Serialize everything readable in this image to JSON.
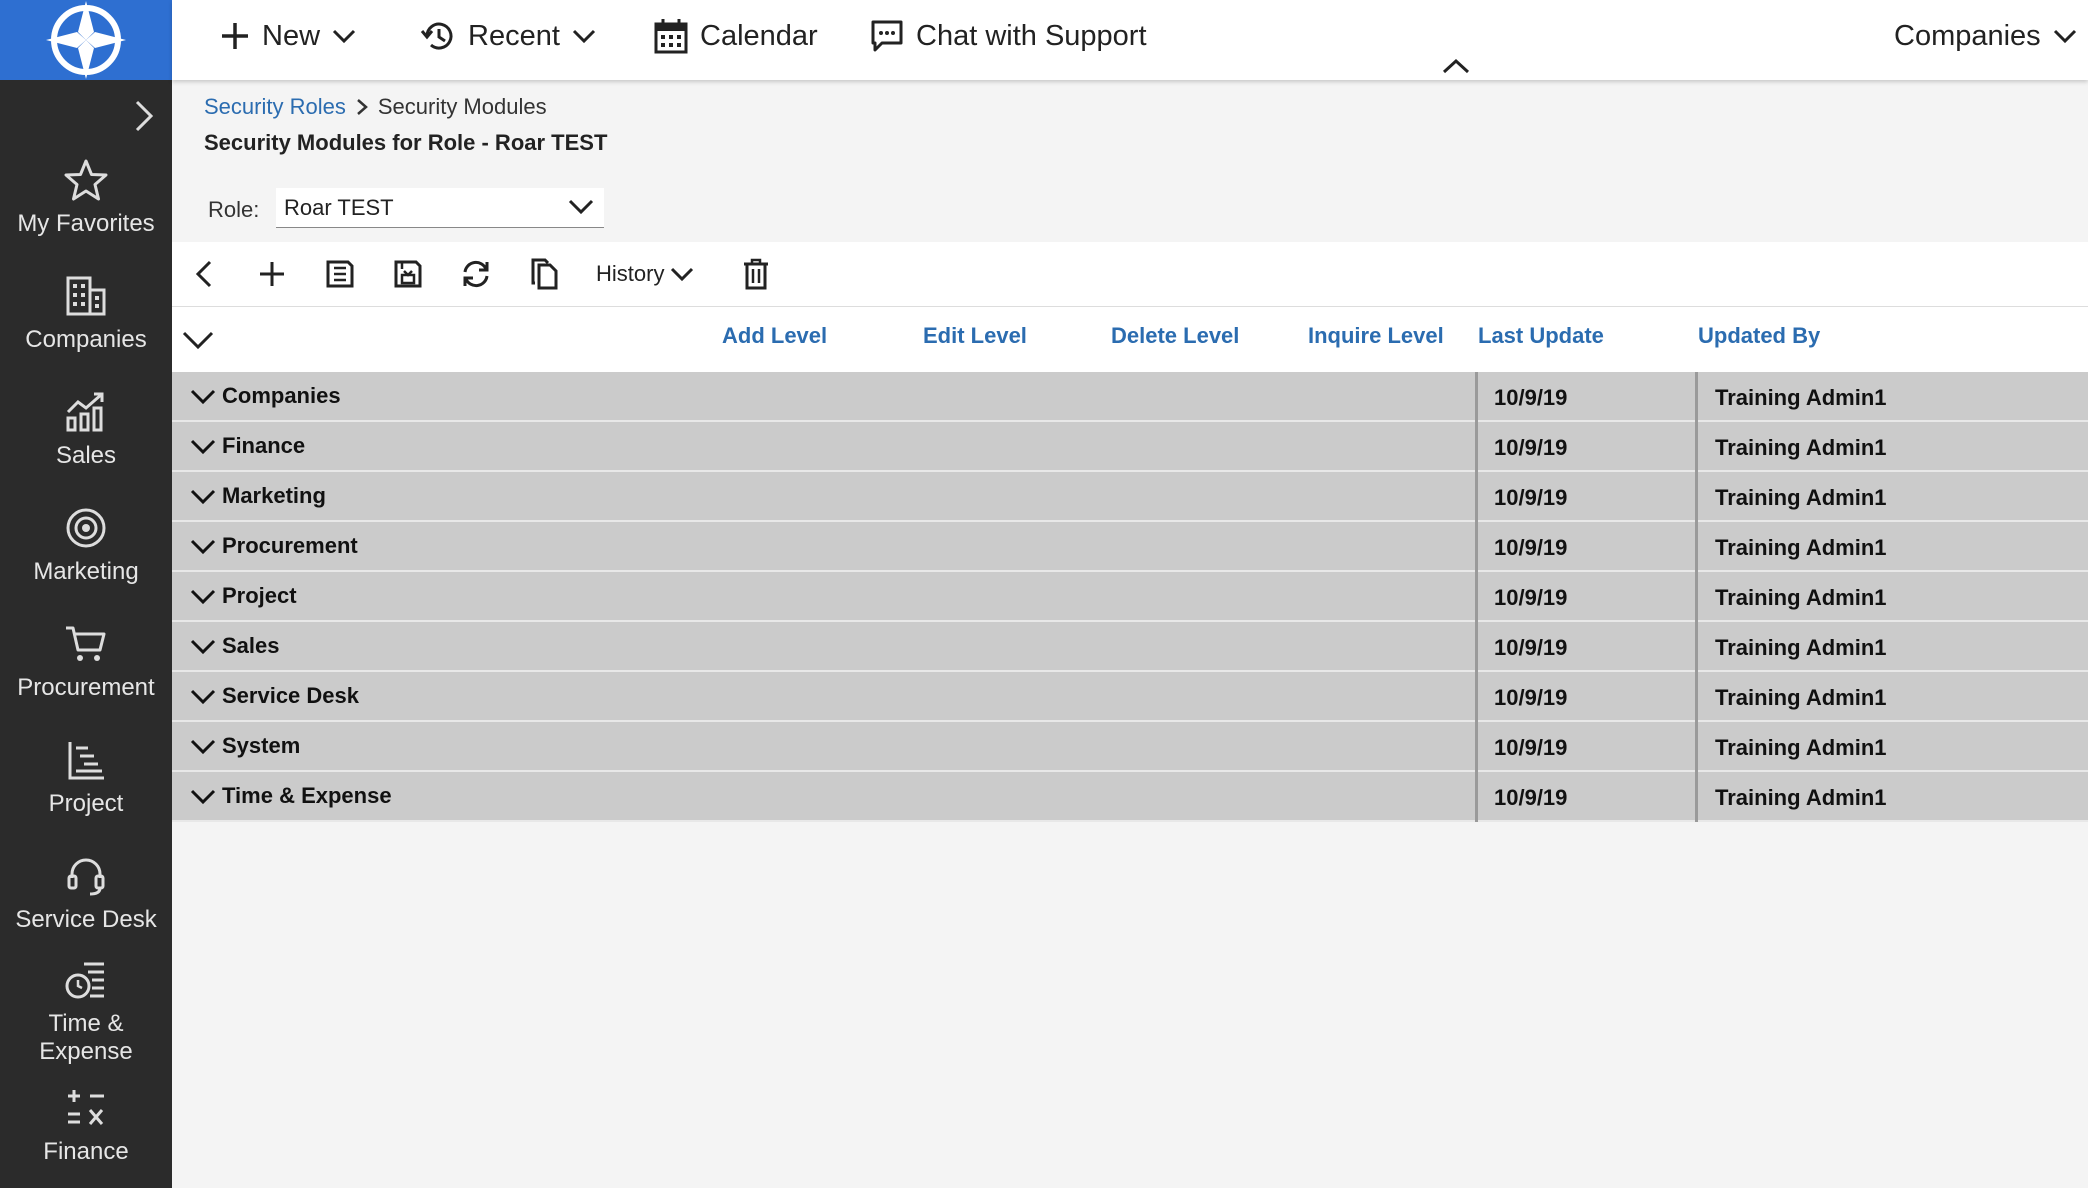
{
  "sidebar": {
    "items": [
      {
        "label": "My Favorites",
        "icon": "star-icon"
      },
      {
        "label": "Companies",
        "icon": "building-icon"
      },
      {
        "label": "Sales",
        "icon": "sales-chart-icon"
      },
      {
        "label": "Marketing",
        "icon": "target-icon"
      },
      {
        "label": "Procurement",
        "icon": "cart-icon"
      },
      {
        "label": "Project",
        "icon": "project-icon"
      },
      {
        "label": "Service Desk",
        "icon": "headset-icon"
      },
      {
        "label": "Time & Expense",
        "icon": "time-expense-icon"
      },
      {
        "label": "Finance",
        "icon": "finance-icon"
      }
    ]
  },
  "topbar": {
    "new_label": "New",
    "recent_label": "Recent",
    "calendar_label": "Calendar",
    "chat_label": "Chat with Support",
    "context_label": "Companies"
  },
  "breadcrumb": {
    "parent": "Security Roles",
    "current": "Security Modules"
  },
  "page_title": "Security Modules for Role - Roar TEST",
  "role": {
    "label": "Role:",
    "value": "Roar TEST"
  },
  "toolbar": {
    "history_label": "History"
  },
  "grid": {
    "columns": [
      "Add Level",
      "Edit Level",
      "Delete Level",
      "Inquire Level",
      "Last Update",
      "Updated By"
    ],
    "rows": [
      {
        "name": "Companies",
        "last_update": "10/9/19",
        "updated_by": "Training Admin1"
      },
      {
        "name": "Finance",
        "last_update": "10/9/19",
        "updated_by": "Training Admin1"
      },
      {
        "name": "Marketing",
        "last_update": "10/9/19",
        "updated_by": "Training Admin1"
      },
      {
        "name": "Procurement",
        "last_update": "10/9/19",
        "updated_by": "Training Admin1"
      },
      {
        "name": "Project",
        "last_update": "10/9/19",
        "updated_by": "Training Admin1"
      },
      {
        "name": "Sales",
        "last_update": "10/9/19",
        "updated_by": "Training Admin1"
      },
      {
        "name": "Service Desk",
        "last_update": "10/9/19",
        "updated_by": "Training Admin1"
      },
      {
        "name": "System",
        "last_update": "10/9/19",
        "updated_by": "Training Admin1"
      },
      {
        "name": "Time & Expense",
        "last_update": "10/9/19",
        "updated_by": "Training Admin1"
      }
    ]
  },
  "colors": {
    "brand_blue": "#2e6fd1",
    "link_blue": "#2b6cb0",
    "sidebar_bg": "#2b2b2b",
    "row_bg": "#cbcbcb"
  }
}
